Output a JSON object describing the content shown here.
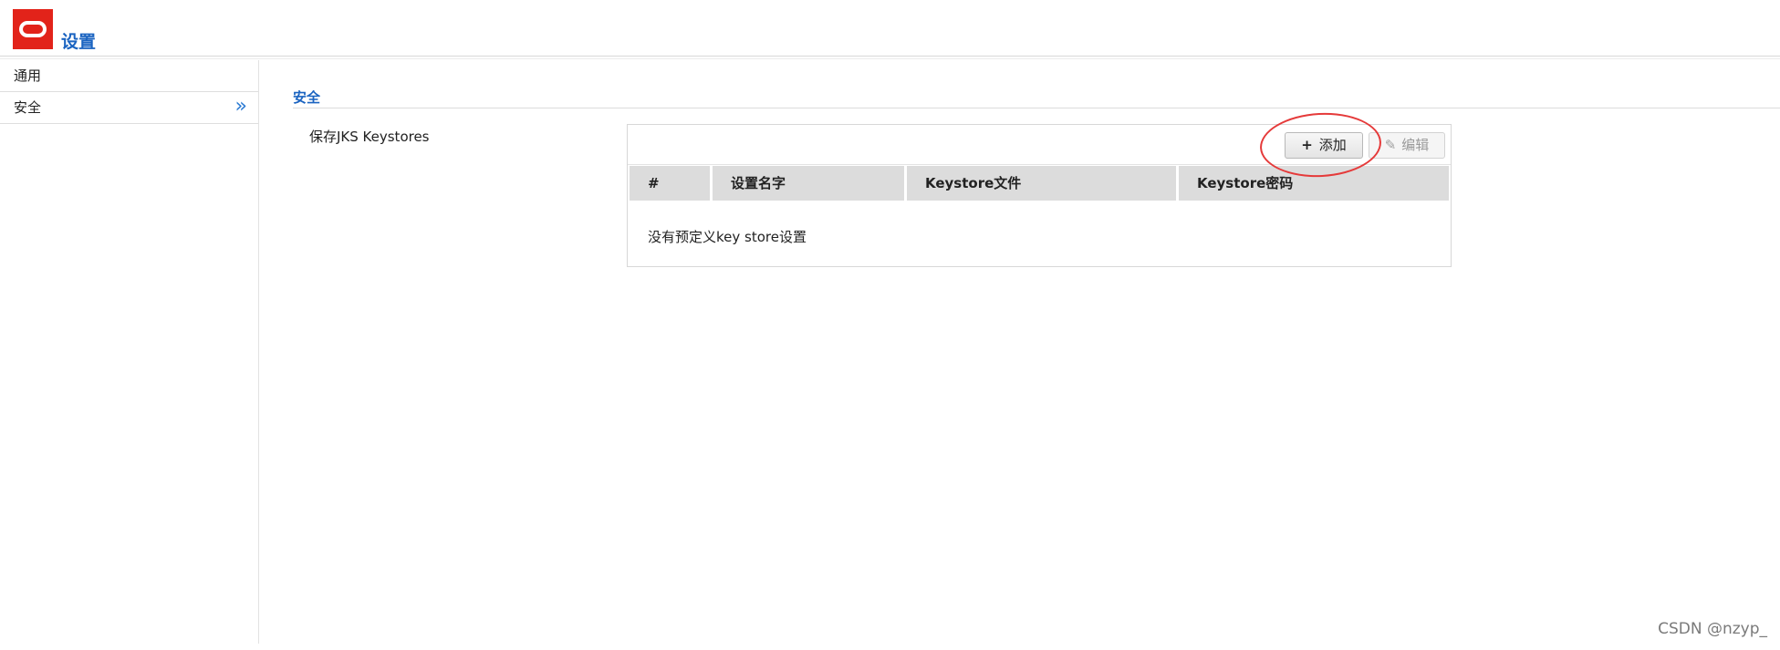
{
  "header": {
    "title": "设置",
    "logo_icon": "oracle-logo-icon",
    "brand_color": "#e2231a",
    "accent_color": "#1b64c1"
  },
  "sidebar": {
    "items": [
      {
        "label": "通用",
        "active": false
      },
      {
        "label": "安全",
        "active": true,
        "indicator": "»"
      }
    ]
  },
  "main": {
    "section_title": "安全",
    "field_label": "保存JKS Keystores",
    "toolbar": {
      "add_label": "添加",
      "add_icon": "+",
      "edit_label": "编辑",
      "edit_icon": "✎"
    },
    "table": {
      "columns": [
        "#",
        "设置名字",
        "Keystore文件",
        "Keystore密码"
      ],
      "empty_message": "没有预定义key store设置"
    }
  },
  "watermark": "CSDN @nzyp_",
  "annotation_color": "#e53a3a"
}
